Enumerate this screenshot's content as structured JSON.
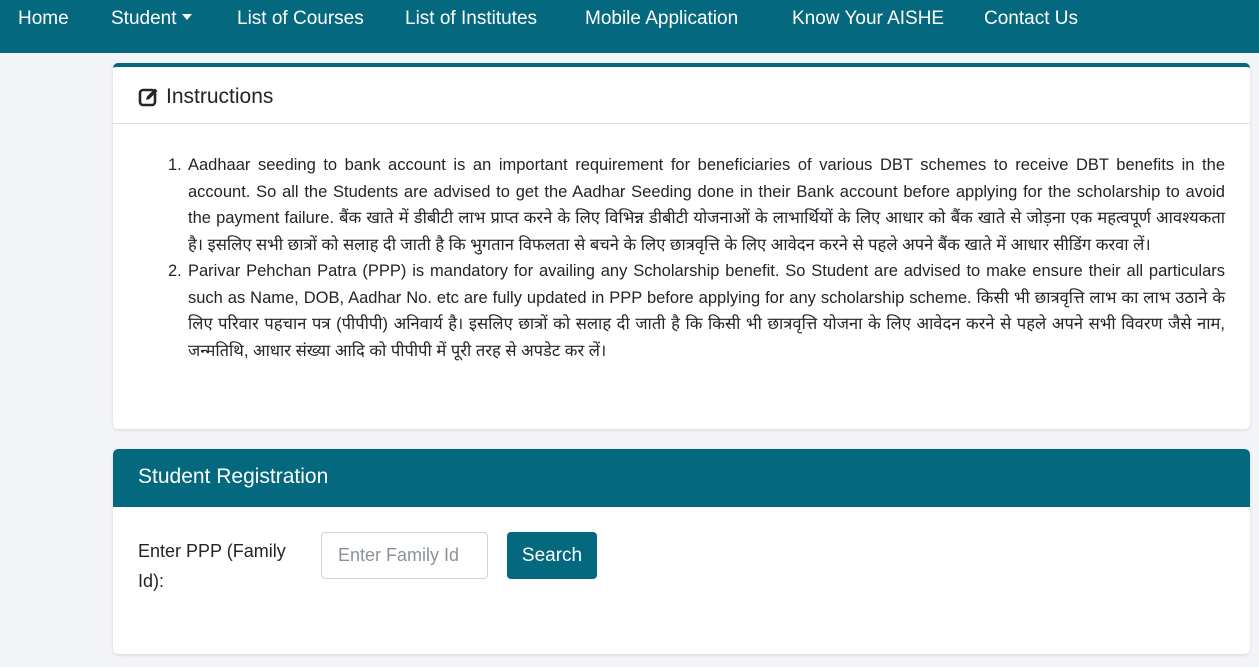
{
  "nav": {
    "items": [
      {
        "label": "Home"
      },
      {
        "label": "Student",
        "has_dropdown": true
      },
      {
        "label": "List of Courses"
      },
      {
        "label": "List of Institutes"
      },
      {
        "label": "Mobile Application"
      },
      {
        "label": "Know Your AISHE"
      },
      {
        "label": "Contact Us"
      }
    ]
  },
  "instructions": {
    "title": "Instructions",
    "icon": "edit-icon",
    "items": [
      {
        "number": "1.",
        "text": "Aadhaar seeding to bank account is an important requirement for beneficiaries of various DBT schemes to receive DBT benefits in the account. So all the Students are advised to get the Aadhar Seeding done in their Bank account before applying for the scholarship to avoid the payment failure. बैंक खाते में डीबीटी लाभ प्राप्त करने के लिए विभिन्न डीबीटी योजनाओं के लाभार्थियों के लिए आधार को बैंक खाते से जोड़ना एक महत्वपूर्ण आवश्यकता है। इसलिए सभी छात्रों को सलाह दी जाती है कि भुगतान विफलता से बचने के लिए छात्रवृत्ति के लिए आवेदन करने से पहले अपने बैंक खाते में आधार सीडिंग करवा लें।"
      },
      {
        "number": "2.",
        "text": "Parivar Pehchan Patra (PPP) is mandatory for availing any Scholarship benefit. So Student are advised to make ensure their all particulars such as Name, DOB, Aadhar No. etc are fully updated in PPP before applying for any scholarship scheme. किसी भी छात्रवृत्ति लाभ का लाभ उठाने के लिए परिवार पहचान पत्र (पीपीपी) अनिवार्य है। इसलिए छात्रों को सलाह दी जाती है कि किसी भी छात्रवृत्ति योजना के लिए आवेदन करने से पहले अपने सभी विवरण जैसे नाम, जन्मतिथि, आधार संख्या आदि को पीपीपी में पूरी तरह से अपडेट कर लें।"
      }
    ]
  },
  "registration": {
    "title": "Student Registration",
    "label": "Enter PPP (Family Id):",
    "input_value": "",
    "input_placeholder": "Enter Family Id",
    "search_label": "Search"
  },
  "colors": {
    "brand": "#04697e",
    "background": "#f3f4f8"
  }
}
